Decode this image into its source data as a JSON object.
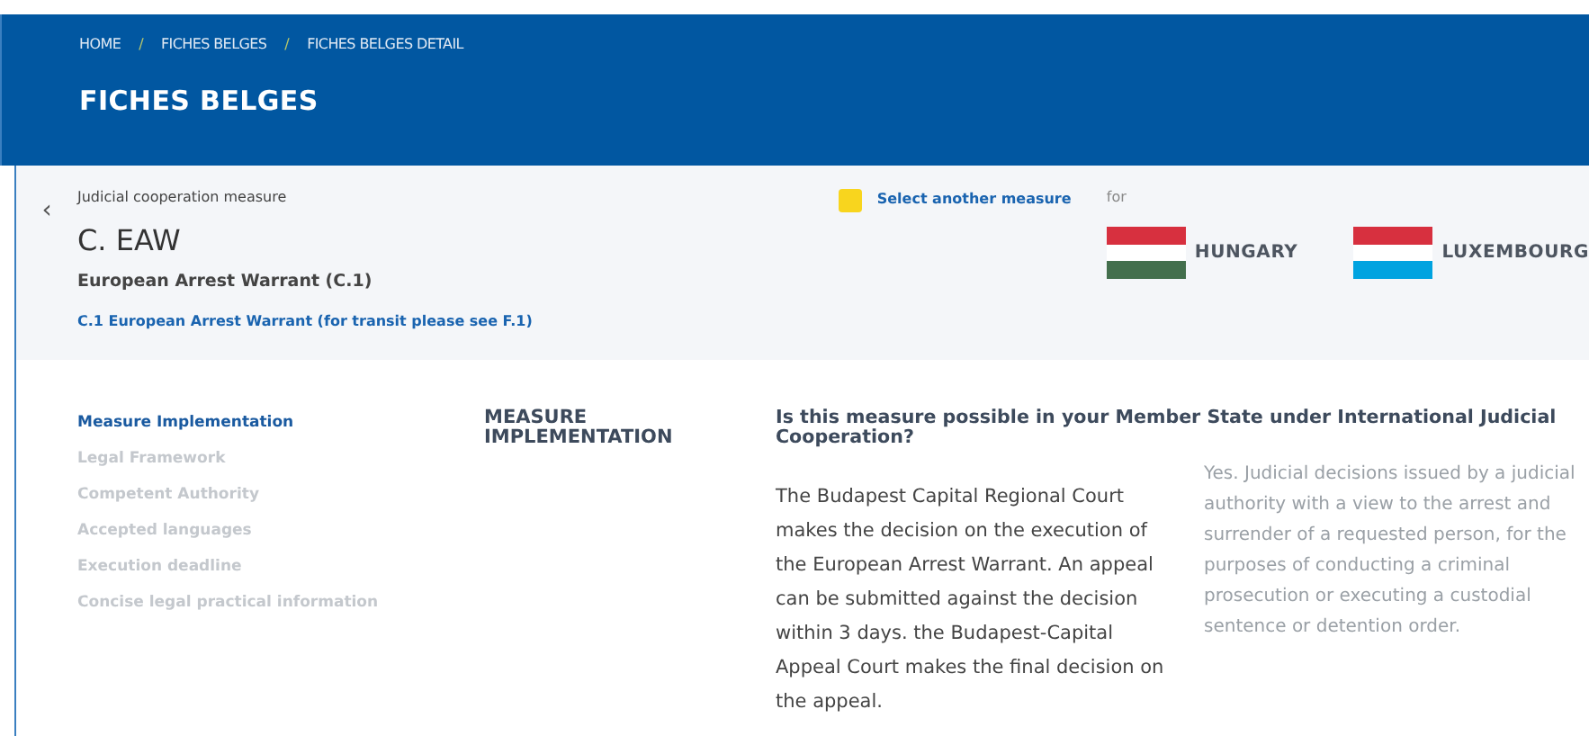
{
  "breadcrumb": [
    {
      "label": "HOME"
    },
    {
      "label": "FICHES BELGES"
    },
    {
      "label": "FICHES BELGES DETAIL"
    }
  ],
  "breadcrumb_separator": "/",
  "page_title": "FICHES BELGES",
  "measure": {
    "back": "‹",
    "label": "Judicial cooperation measure",
    "code": "C. EAW",
    "name": "European Arrest Warrant (C.1)",
    "link": "C.1 European Arrest Warrant (for transit please see F.1)",
    "select_action": "Select another measure",
    "for_label": "for"
  },
  "countries": [
    {
      "name": "HUNGARY",
      "color": "#436f4d"
    },
    {
      "name": "LUXEMBOURG",
      "color": "#00a3e0"
    }
  ],
  "side_nav": [
    {
      "label": "Measure Implementation",
      "selected": true
    },
    {
      "label": "Legal Framework",
      "selected": false
    },
    {
      "label": "Competent Authority",
      "selected": false
    },
    {
      "label": "Accepted languages",
      "selected": false
    },
    {
      "label": "Execution deadline",
      "selected": false
    },
    {
      "label": "Concise legal practical information",
      "selected": false
    }
  ],
  "section_heading": "MEASURE IMPLEMENTATION",
  "question": "Is this measure possible in your Member State under International Judicial Cooperation?",
  "answers": [
    "The Budapest Capital Regional Court makes the decision on the execution of the European Arrest Warrant. An appeal can be submitted against the decision within 3 days. the Budapest-Capital Appeal Court makes the final decision on the appeal.",
    "Yes. Judicial decisions issued by a judicial authority with a view to the arrest and surrender of a requested person, for the purposes of conducting a criminal prosecution or executing a custodial sentence or detention order."
  ]
}
